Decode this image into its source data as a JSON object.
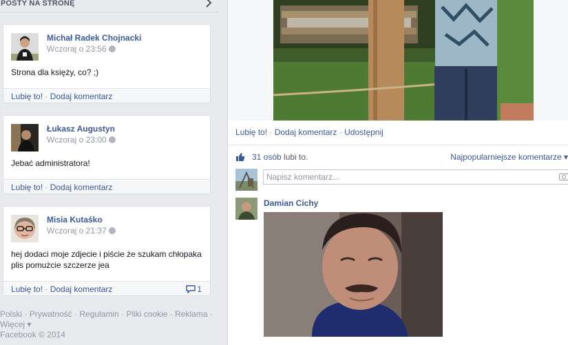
{
  "left_header": {
    "title": "POSTY NA STRONĘ"
  },
  "posts": [
    {
      "author": "Michał Radek Chojnacki",
      "time": "Wczoraj o 23:56",
      "text": "Strona dla księży, co? ;)",
      "like": "Lubię to!",
      "comment": "Dodaj komentarz"
    },
    {
      "author": "Łukasz Augustyn",
      "time": "Wczoraj o 23:00",
      "text": "Jebać administratora!",
      "like": "Lubię to!",
      "comment": "Dodaj komentarz"
    },
    {
      "author": "Misia Kutaśko",
      "time": "Wczoraj o 21:37",
      "text": "hej dodaci moje zdjecie i piście że szukam chłopaka plis pomużcie szczerze jea",
      "like": "Lubię to!",
      "comment": "Dodaj komentarz",
      "comment_count": "1"
    }
  ],
  "footer": {
    "links": [
      "Polski",
      "Prywatność",
      "Regulamin",
      "Pliki cookie",
      "Reklama",
      "Więcej ▾"
    ],
    "copyright": "Facebook © 2014"
  },
  "photo_actions": {
    "like": "Lubię to!",
    "comment": "Dodaj komentarz",
    "share": "Udostępnij"
  },
  "likes": {
    "count": "31 osób",
    "suffix": " lubi to.",
    "popular": "Najpopularniejsze komentarze ▾"
  },
  "composer": {
    "placeholder": "Napisz komentarz..."
  },
  "comments": [
    {
      "author": "Damian Cichy"
    }
  ],
  "colors": {
    "link": "#3b5998",
    "page_bg": "#e9eaed",
    "meta": "#9197a3"
  },
  "icons": {
    "globe": "globe-icon",
    "chevron": "chevron-right-icon",
    "thumb": "thumbs-up-icon",
    "camera": "camera-icon",
    "bubble": "comment-bubble-icon"
  }
}
